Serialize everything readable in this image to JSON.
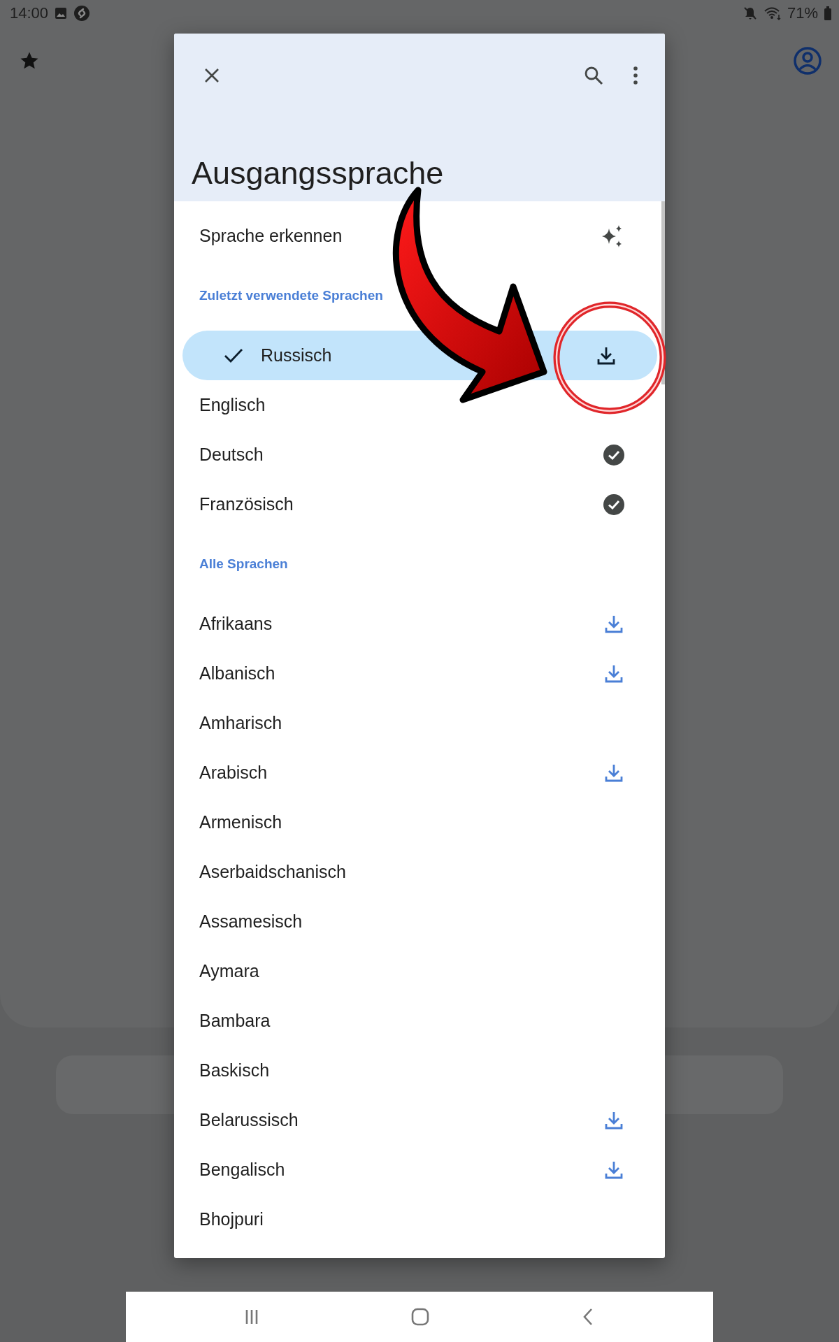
{
  "status_bar": {
    "time": "14:00",
    "battery": "71%"
  },
  "dialog": {
    "title": "Ausgangssprache",
    "detect": {
      "label": "Sprache erkennen"
    },
    "sections": [
      {
        "heading": "Zuletzt verwendete Sprachen",
        "items": [
          {
            "name": "Russisch",
            "selected": true,
            "kind": "download"
          },
          {
            "name": "Englisch",
            "selected": false,
            "kind": "plain"
          },
          {
            "name": "Deutsch",
            "selected": false,
            "kind": "downloaded"
          },
          {
            "name": "Französisch",
            "selected": false,
            "kind": "downloaded"
          }
        ]
      },
      {
        "heading": "Alle Sprachen",
        "items": [
          {
            "name": "Afrikaans",
            "selected": false,
            "kind": "download"
          },
          {
            "name": "Albanisch",
            "selected": false,
            "kind": "download"
          },
          {
            "name": "Amharisch",
            "selected": false,
            "kind": "plain"
          },
          {
            "name": "Arabisch",
            "selected": false,
            "kind": "download"
          },
          {
            "name": "Armenisch",
            "selected": false,
            "kind": "plain"
          },
          {
            "name": "Aserbaidschanisch",
            "selected": false,
            "kind": "plain"
          },
          {
            "name": "Assamesisch",
            "selected": false,
            "kind": "plain"
          },
          {
            "name": "Aymara",
            "selected": false,
            "kind": "plain"
          },
          {
            "name": "Bambara",
            "selected": false,
            "kind": "plain"
          },
          {
            "name": "Baskisch",
            "selected": false,
            "kind": "plain"
          },
          {
            "name": "Belarussisch",
            "selected": false,
            "kind": "download"
          },
          {
            "name": "Bengalisch",
            "selected": false,
            "kind": "download"
          },
          {
            "name": "Bhojpuri",
            "selected": false,
            "kind": "plain"
          }
        ]
      }
    ]
  }
}
